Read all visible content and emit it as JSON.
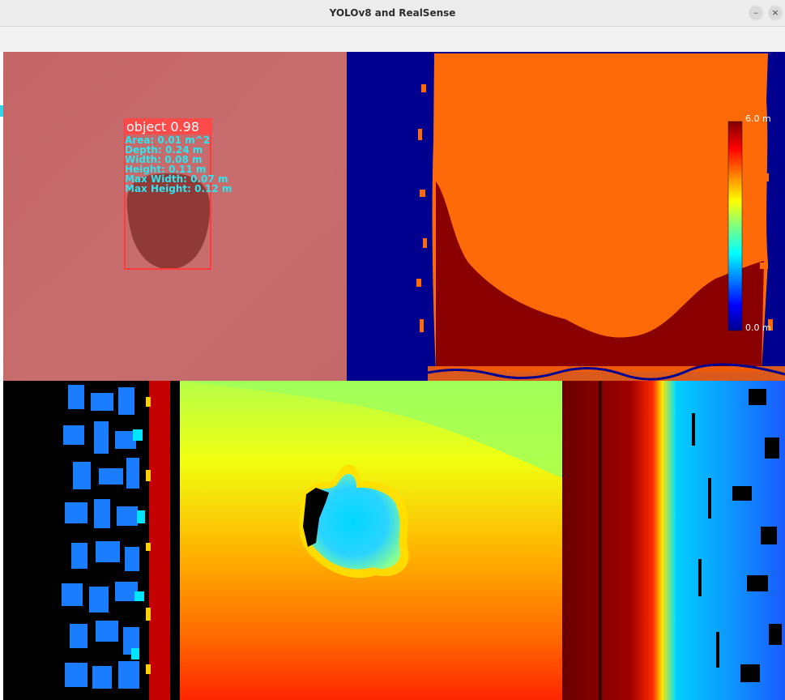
{
  "window": {
    "title": "YOLOv8 and RealSense",
    "minimize_glyph": "–",
    "close_glyph": "×"
  },
  "detection": {
    "label": "object 0.98",
    "lines": [
      "Area: 0.01 m^2",
      "Depth: 0.24 m",
      "Width: 0.08 m",
      "Height: 0.11 m",
      "Max Width: 0.07 m",
      "Max Height: 0.12 m"
    ],
    "box_color": "#ff3c3c",
    "text_color": "#2fe6f0"
  },
  "colorbar": {
    "max_label": "6.0 m",
    "min_label": "0.0 m",
    "colormap": "jet"
  },
  "colors": {
    "rgb_background": "#c86a6b",
    "depth_far": "#ff6a08",
    "depth_near": "#8a0000",
    "invalid": "#00008f"
  },
  "icons": [
    "minimize-icon",
    "close-icon"
  ]
}
